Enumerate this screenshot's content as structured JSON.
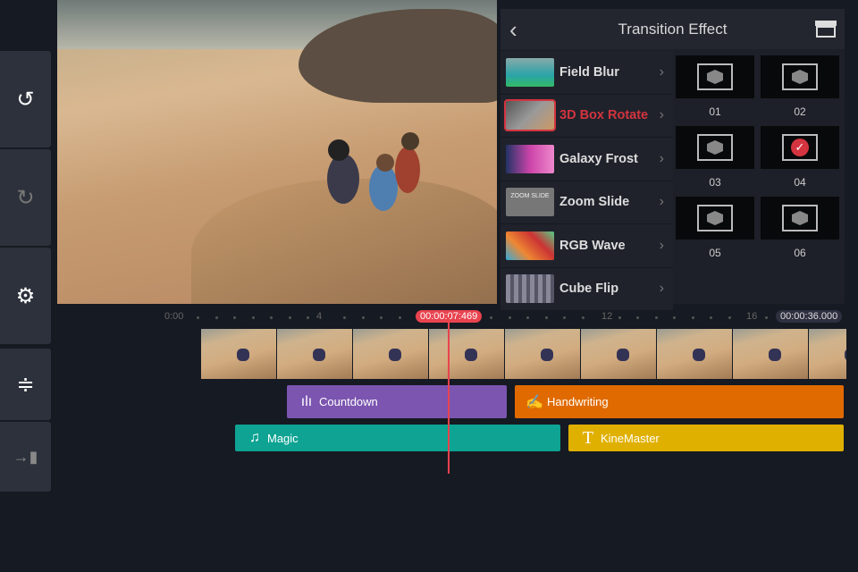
{
  "sidebar": {
    "buttons": [
      {
        "name": "undo-button",
        "icon": "undo-icon"
      },
      {
        "name": "redo-button",
        "icon": "redo-icon"
      },
      {
        "name": "settings-button",
        "icon": "gear-icon"
      },
      {
        "name": "track-height-button",
        "icon": "align-icon"
      },
      {
        "name": "exit-button",
        "icon": "exit-icon"
      }
    ]
  },
  "panel": {
    "title": "Transition Effect",
    "effects": [
      {
        "label": "Field Blur"
      },
      {
        "label": "3D Box Rotate",
        "selected": true
      },
      {
        "label": "Galaxy Frost"
      },
      {
        "label": "Zoom Slide"
      },
      {
        "label": "RGB Wave"
      },
      {
        "label": "Cube Flip"
      }
    ],
    "zoom_slide_thumb_text": "ZOOM SLIDE",
    "variants": [
      {
        "label": "01"
      },
      {
        "label": "02"
      },
      {
        "label": "03"
      },
      {
        "label": "04",
        "selected": true
      },
      {
        "label": "05"
      },
      {
        "label": "06"
      }
    ]
  },
  "timeline": {
    "ticks": [
      "0:00",
      "4",
      "12",
      "16"
    ],
    "current_time": "00:00:07:469",
    "total_time": "00:00:36.000",
    "clips": {
      "countdown": "Countdown",
      "handwriting": "Handwriting",
      "magic": "Magic",
      "kinemaster": "KineMaster"
    }
  },
  "colors": {
    "accent": "#d3343f",
    "countdown": "#7b55b0",
    "handwriting": "#e06a00",
    "magic": "#0ea393",
    "kinemaster": "#e0b000"
  }
}
